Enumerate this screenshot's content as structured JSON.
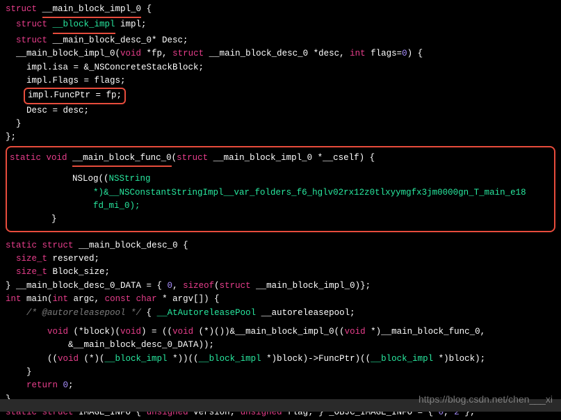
{
  "code": {
    "l1_kw1": "struct",
    "l1_name": "__main_block_impl_0",
    "l1_brace": " {",
    "l2_kw": "  struct",
    "l2_name": "__block_impl",
    "l2_rest": " impl;",
    "l3_kw": "  struct",
    "l3_rest": " __main_block_desc_0* Desc;",
    "l4_a": "  __main_block_impl_0(",
    "l4_kw1": "void",
    "l4_b": " *fp, ",
    "l4_kw2": "struct",
    "l4_c": " __main_block_desc_0 *desc, ",
    "l4_kw3": "int",
    "l4_d": " flags=",
    "l4_num": "0",
    "l4_e": ") {",
    "l5": "    impl.isa = &_NSConcreteStackBlock;",
    "l6": "    impl.Flags = flags;",
    "l7": "impl.FuncPtr = fp;",
    "l8": "    Desc = desc;",
    "l9": "  }",
    "l10": "};",
    "l11_kw1": "static",
    "l11_kw2": "void",
    "l11_name": "__main_block_func_0",
    "l11_a": "(",
    "l11_kw3": "struct",
    "l11_b": " __main_block_impl_0 *__cself) {",
    "l12_a": "            NSLog((",
    "l12_type": "NSString",
    "l13": "                *)&__NSConstantStringImpl__var_folders_f6_hglv02rx12z0tlxyymgfx3jm0000gn_T_main_e18",
    "l14": "                fd_mi_0);",
    "l15": "        }",
    "l16_kw1": "static",
    "l16_kw2": "struct",
    "l16_rest": " __main_block_desc_0 {",
    "l17_kw": "  size_t",
    "l17_rest": " reserved;",
    "l18_kw": "  size_t",
    "l18_rest": " Block_size;",
    "l19_a": "} __main_block_desc_0_DATA = { ",
    "l19_n1": "0",
    "l19_b": ", ",
    "l19_kw": "sizeof",
    "l19_c": "(",
    "l19_kw2": "struct",
    "l19_d": " __main_block_impl_0)};",
    "l20_kw1": "int",
    "l20_a": " main(",
    "l20_kw2": "int",
    "l20_b": " argc, ",
    "l20_kw3": "const",
    "l20_kw4": "char",
    "l20_c": " * argv[]) {",
    "l21_c": "    /* @autoreleasepool */",
    "l21_a": " { ",
    "l21_type": "__AtAutoreleasePool",
    "l21_b": " __autoreleasepool;",
    "l22_kw1": "        void",
    "l22_a": " (*block)(",
    "l22_kw2": "void",
    "l22_b": ") = ((",
    "l22_kw3": "void",
    "l22_c": " (*)())&__main_block_impl_0((",
    "l22_kw4": "void",
    "l22_d": " *)__main_block_func_0,",
    "l23": "            &__main_block_desc_0_DATA));",
    "l24_a": "        ((",
    "l24_kw1": "void",
    "l24_b": " (*)(",
    "l24_type1": "__block_impl",
    "l24_c": " *))((",
    "l24_type2": "__block_impl",
    "l24_d": " *)block)->FuncPtr)((",
    "l24_type3": "__block_impl",
    "l24_e": " *)block);",
    "l25": "    }",
    "l26_kw": "    return",
    "l26_n": "0",
    "l26_a": ";",
    "l27": "}",
    "l28_kw1": "static",
    "l28_kw2": "struct",
    "l28_a": " IMAGE_INFO { ",
    "l28_kw3": "unsigned",
    "l28_b": " version; ",
    "l28_kw4": "unsigned",
    "l28_c": " flag; } _OBJC_IMAGE_INFO = { ",
    "l28_n1": "0",
    "l28_d": ", ",
    "l28_n2": "2",
    "l28_e": " };"
  },
  "watermark": "https://blog.csdn.net/chen___xi"
}
